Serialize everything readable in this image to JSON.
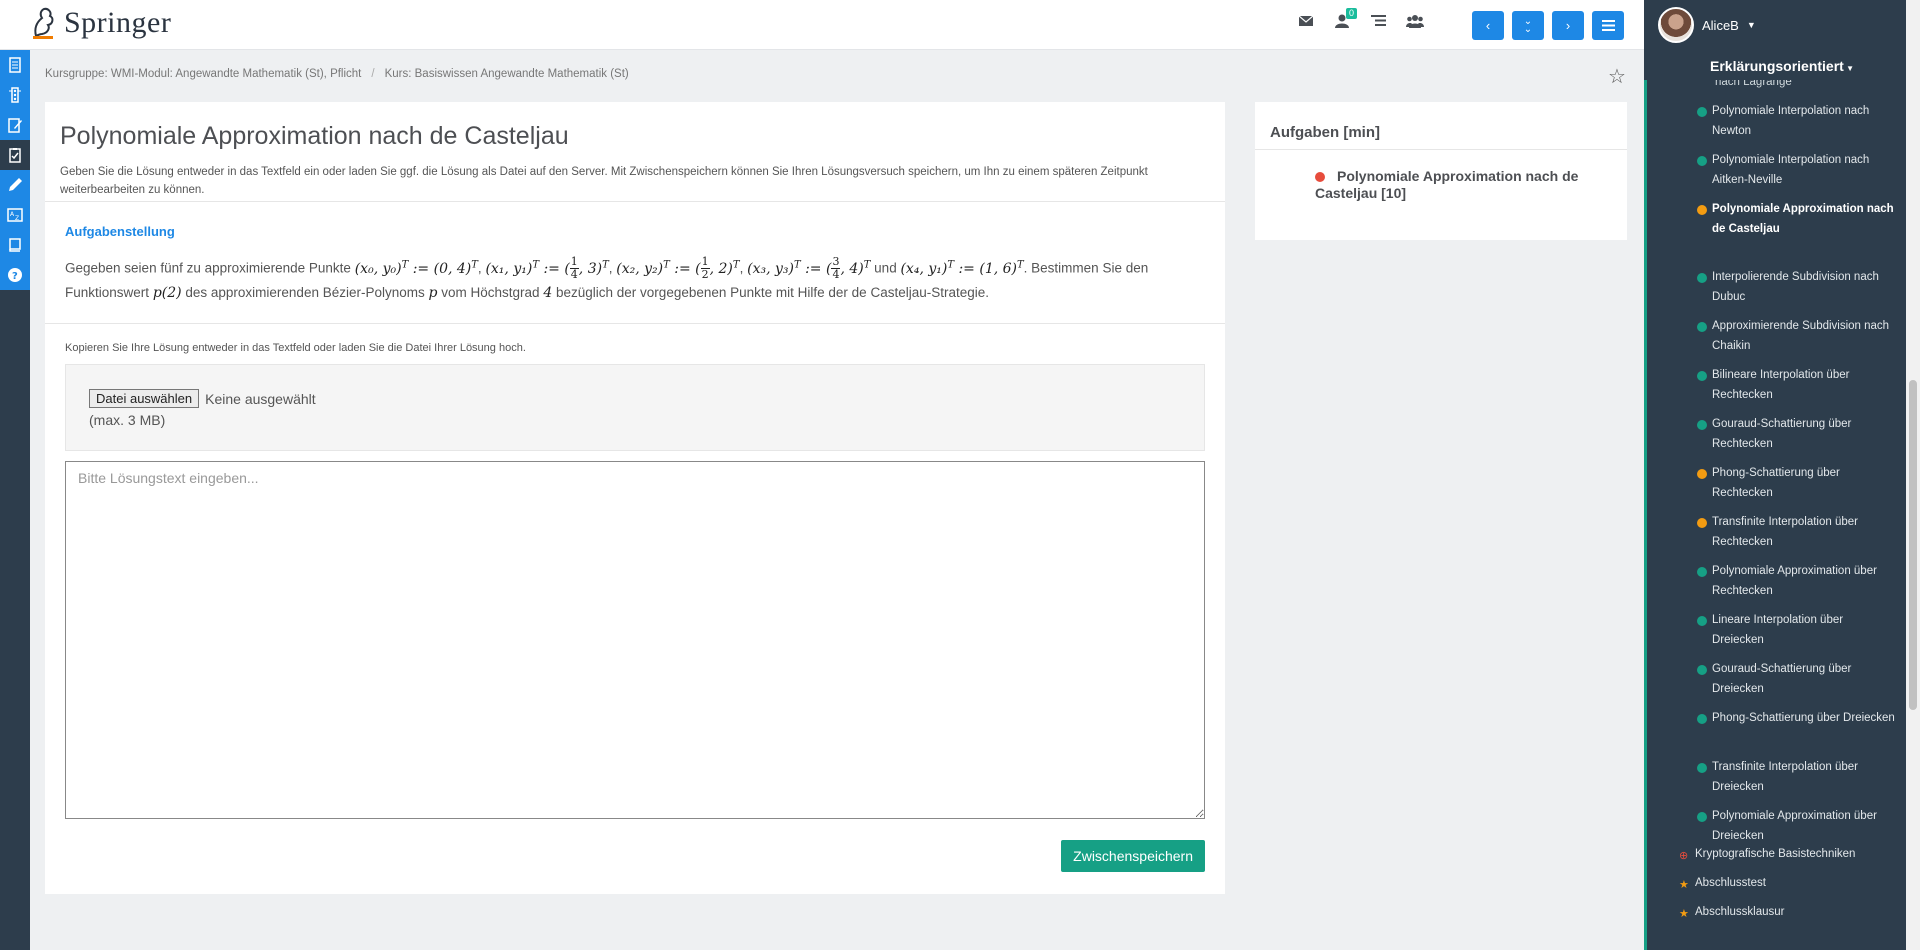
{
  "brand": {
    "name": "Springer"
  },
  "header": {
    "icons": [
      "envelope-icon",
      "user-notification-icon",
      "list-icon",
      "group-icon"
    ],
    "notification_count": "0",
    "nav_buttons": [
      "previous",
      "expand-down",
      "next",
      "menu"
    ]
  },
  "breadcrumb": {
    "items": [
      "Kursgruppe: WMI-Modul: Angewandte Mathematik (St), Pflicht",
      "Kurs: Basiswissen Angewandte Mathematik (St)"
    ],
    "separator": "/"
  },
  "main": {
    "title": "Polynomiale Approximation nach de Casteljau",
    "description": "Geben Sie die Lösung entweder in das Textfeld ein oder laden Sie ggf. die Lösung als Datei auf den Server. Mit Zwischenspeichern können Sie Ihren Lösungsversuch speichern, um Ihn zu einem späteren Zeitpunkt weiterbearbeiten zu können.",
    "task_heading": "Aufgabenstellung",
    "task": {
      "t1": "Gegeben seien fünf zu approximierende Punkte",
      "t2": "und",
      "t3": ". Bestimmen Sie den Funktionswert",
      "t4": "des approximierenden Bézier-Polynoms",
      "t5": "vom Höchstgrad",
      "t6": "bezüglich der vorgegebenen Punkte mit Hilfe der de Casteljau-Strategie.",
      "p0": "(x₀, y₀)",
      "p0v": ":= (0, 4)",
      "p1": "(x₁, y₁)",
      "p1a": ":= (",
      "p1b": ", 3)",
      "p2": "(x₂, y₂)",
      "p2a": ":= (",
      "p2b": ", 2)",
      "p3": "(x₃, y₃)",
      "p3a": ":= (",
      "p3b": ", 4)",
      "p4": "(x₄, y₁)",
      "p4v": ":= (1, 6)",
      "frac1_num": "1",
      "frac1_den": "4",
      "frac2_num": "1",
      "frac2_den": "2",
      "frac3_num": "3",
      "frac3_den": "4",
      "sup": "T",
      "sep": ",",
      "fn": "p(2)",
      "poly": "p",
      "deg": "4"
    },
    "upload_hint": "Kopieren Sie Ihre Lösung entweder in das Textfeld oder laden Sie die Datei Ihrer Lösung hoch.",
    "file_button": "Datei auswählen",
    "file_status": "Keine ausgewählt",
    "file_max": "(max. 3 MB)",
    "answer_placeholder": "Bitte Lösungstext eingeben...",
    "save_button": "Zwischenspeichern"
  },
  "tasks_panel": {
    "title": "Aufgaben [min]",
    "items": [
      {
        "label": "Polynomiale Approximation nach de Casteljau [10]",
        "status_color": "#e74c3c"
      }
    ]
  },
  "sidebar": {
    "user": "AliceB",
    "mode": "Erklärungsorientiert",
    "cut_item": "nach Lagrange",
    "items": [
      {
        "label": "Polynomiale Interpolation nach Newton",
        "color": "#16a085"
      },
      {
        "label": "Polynomiale Interpolation nach Aitken-Neville",
        "color": "#16a085"
      },
      {
        "label": "Polynomiale Approximation nach de Casteljau",
        "color": "#f39c12",
        "active": true
      },
      {
        "label": "Interpolierende Subdivision nach Dubuc",
        "color": "#16a085"
      },
      {
        "label": "Approximierende Subdivision nach Chaikin",
        "color": "#16a085"
      },
      {
        "label": "Bilineare Interpolation über Rechtecken",
        "color": "#16a085"
      },
      {
        "label": "Gouraud-Schattierung über Rechtecken",
        "color": "#16a085"
      },
      {
        "label": "Phong-Schattierung über Rechtecken",
        "color": "#f39c12"
      },
      {
        "label": "Transfinite Interpolation über Rechtecken",
        "color": "#f39c12"
      },
      {
        "label": "Polynomiale Approximation über Rechtecken",
        "color": "#16a085"
      },
      {
        "label": "Lineare Interpolation über Dreiecken",
        "color": "#16a085"
      },
      {
        "label": "Gouraud-Schattierung über Dreiecken",
        "color": "#16a085"
      },
      {
        "label": "Phong-Schattierung über Dreiecken",
        "color": "#16a085"
      },
      {
        "label": "Transfinite Interpolation über Dreiecken",
        "color": "#16a085"
      },
      {
        "label": "Polynomiale Approximation über Dreiecken",
        "color": "#16a085"
      }
    ],
    "sub_items": [
      {
        "label": "Kryptografische Basistechniken",
        "icon": "plus-circle-icon",
        "color": "#e74c3c"
      },
      {
        "label": "Abschlusstest",
        "icon": "star-icon",
        "color": "#f39c12"
      },
      {
        "label": "Abschlussklausur",
        "icon": "star-icon",
        "color": "#f39c12"
      }
    ]
  },
  "colors": {
    "accent": "#1e88e5",
    "success": "#16a085",
    "warning": "#f39c12",
    "danger": "#e74c3c",
    "sidebar_bg": "#2d3d4c"
  }
}
